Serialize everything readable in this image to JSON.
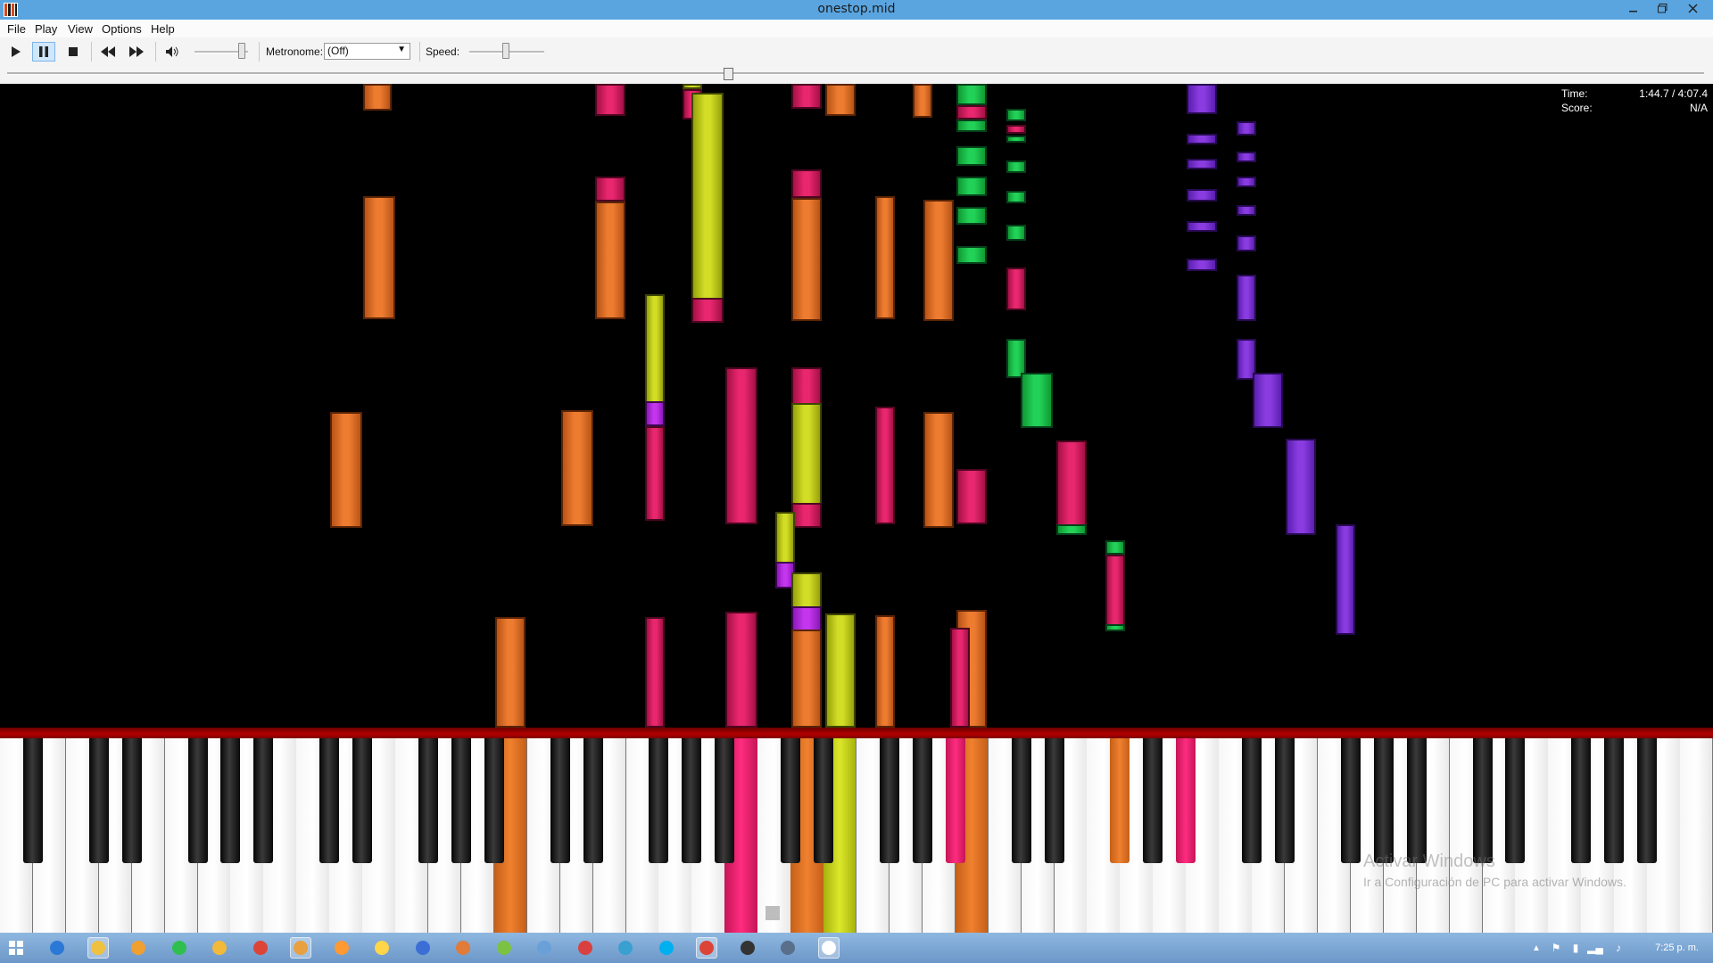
{
  "window": {
    "title": "onestop.mid"
  },
  "menu": [
    "File",
    "Play",
    "View",
    "Options",
    "Help"
  ],
  "toolbar": {
    "metronome_label": "Metronome:",
    "metronome_value": "(Off)",
    "speed_label": "Speed:"
  },
  "playback": {
    "elapsed": "1:44.7",
    "total": "4:07.4",
    "progress": 0.425
  },
  "info": {
    "time_label": "Time:",
    "time_value": "1:44.7 / 4:07.4",
    "score_label": "Score:",
    "score_value": "N/A"
  },
  "watermark": {
    "line1": "Activar Windows",
    "line2": "Ir a Configuración de PC para activar Windows."
  },
  "taskbar": {
    "clock": "7:25 p. m."
  },
  "colors": {
    "orange": "#ee7c30",
    "pink": "#e8276f",
    "yellow": "#d2dd25",
    "green": "#22d158",
    "purple": "#8a3ce0",
    "magenta": "#c436ee",
    "titlebar": "#5aa5e0",
    "taskbar": "#7aa3d3"
  },
  "icons": {
    "play": "play-icon",
    "pause": "pause-icon",
    "stop": "stop-icon",
    "rewind": "rewind-icon",
    "forward": "fast-forward-icon",
    "volume": "volume-icon"
  }
}
